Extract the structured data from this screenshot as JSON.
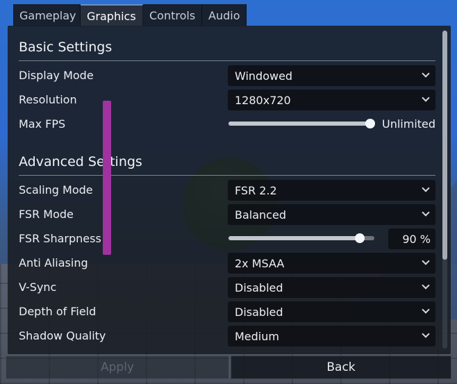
{
  "tabs": [
    {
      "label": "Gameplay"
    },
    {
      "label": "Graphics"
    },
    {
      "label": "Controls"
    },
    {
      "label": "Audio"
    }
  ],
  "basic": {
    "title": "Basic Settings",
    "display_mode": {
      "label": "Display Mode",
      "value": "Windowed"
    },
    "resolution": {
      "label": "Resolution",
      "value": "1280x720"
    },
    "max_fps": {
      "label": "Max FPS",
      "value": "Unlimited",
      "level": 1.0
    }
  },
  "advanced": {
    "title": "Advanced Settings",
    "scaling_mode": {
      "label": "Scaling Mode",
      "value": "FSR 2.2"
    },
    "fsr_mode": {
      "label": "FSR Mode",
      "value": "Balanced"
    },
    "fsr_sharpness": {
      "label": "FSR Sharpness",
      "value": "90 %",
      "level": 0.9
    },
    "anti_aliasing": {
      "label": "Anti Aliasing",
      "value": "2x MSAA"
    },
    "vsync": {
      "label": "V-Sync",
      "value": "Disabled"
    },
    "depth_of_field": {
      "label": "Depth of Field",
      "value": "Disabled"
    },
    "shadow_quality": {
      "label": "Shadow Quality",
      "value": "Medium"
    }
  },
  "buttons": {
    "apply": "Apply",
    "back": "Back"
  },
  "colors": {
    "sky": "#2f6ad0",
    "ball": "#2f6e29",
    "pillar": "#a0339f",
    "panel": "#1b1f26"
  }
}
